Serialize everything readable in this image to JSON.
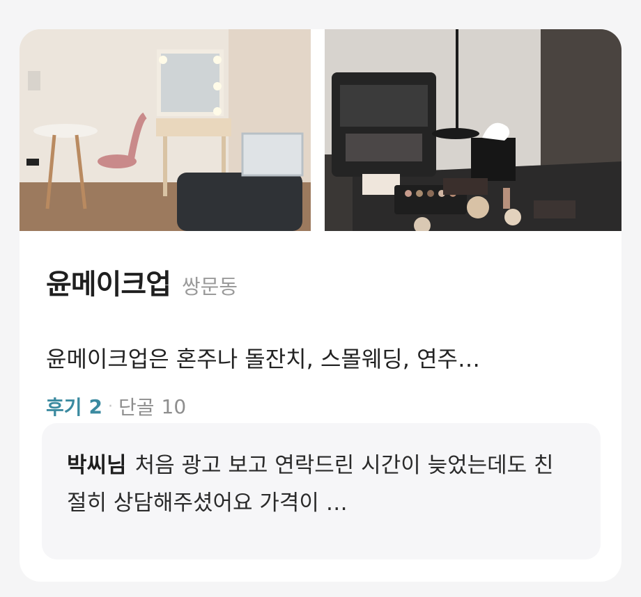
{
  "listing": {
    "name": "윤메이크업",
    "area": "쌍문동",
    "description": "윤메이크업은 혼주나 돌잔치, 스몰웨딩, 연주…",
    "review_label": "후기",
    "review_count": "2",
    "regular_label": "단골",
    "regular_count": "10",
    "dot": "·"
  },
  "photos": [
    {
      "subject": "makeup studio room with vanity mirror, round table and pink chair"
    },
    {
      "subject": "makeup kit case and eyeshadow palettes on dark table"
    }
  ],
  "review": {
    "author": "박씨님",
    "text": "처음 광고 보고 연락드린 시간이 늦었는데도 친절히 상담해주셨어요 가격이 …"
  }
}
